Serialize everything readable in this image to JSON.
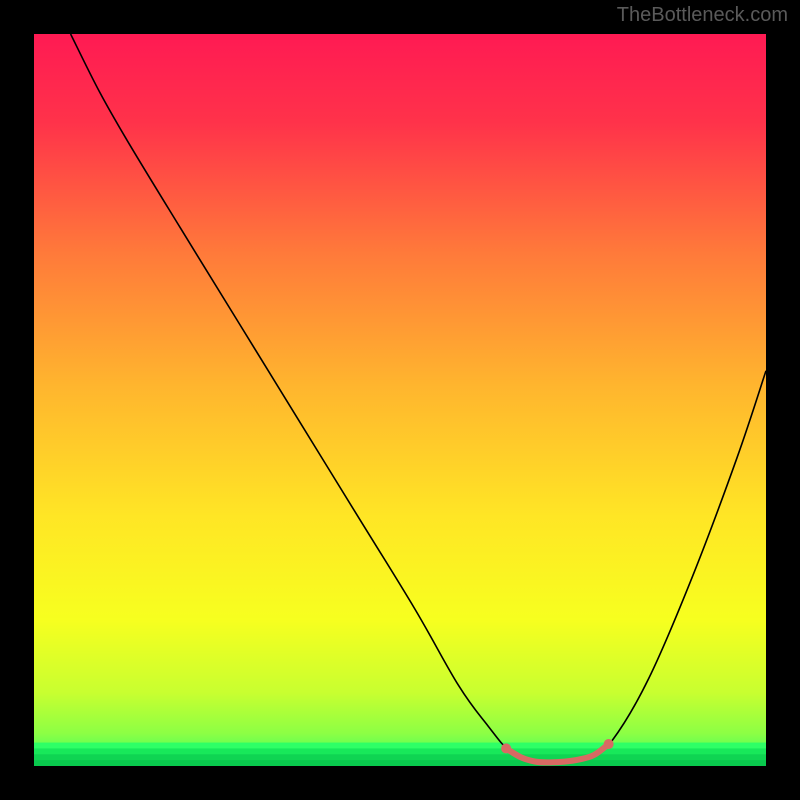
{
  "chart_data": {
    "type": "line",
    "attribution": "TheBottleneck.com",
    "title": "",
    "xlabel": "",
    "ylabel": "",
    "xlim": [
      0,
      100
    ],
    "ylim": [
      0,
      100
    ],
    "background_gradient": {
      "stops": [
        {
          "offset": 0.0,
          "color": "#ff1a53"
        },
        {
          "offset": 0.12,
          "color": "#ff324a"
        },
        {
          "offset": 0.3,
          "color": "#ff7a3a"
        },
        {
          "offset": 0.48,
          "color": "#ffb52e"
        },
        {
          "offset": 0.66,
          "color": "#ffe625"
        },
        {
          "offset": 0.8,
          "color": "#f7ff1f"
        },
        {
          "offset": 0.9,
          "color": "#c8ff30"
        },
        {
          "offset": 0.955,
          "color": "#8dff44"
        },
        {
          "offset": 1.0,
          "color": "#2eff66"
        }
      ]
    },
    "curve": {
      "color": "#000000",
      "width": 1.6,
      "points": [
        {
          "x": 5.0,
          "y": 100.0
        },
        {
          "x": 9.0,
          "y": 92.0
        },
        {
          "x": 13.0,
          "y": 85.0
        },
        {
          "x": 20.0,
          "y": 73.5
        },
        {
          "x": 28.0,
          "y": 60.5
        },
        {
          "x": 36.0,
          "y": 47.5
        },
        {
          "x": 44.0,
          "y": 34.5
        },
        {
          "x": 52.0,
          "y": 21.5
        },
        {
          "x": 58.0,
          "y": 11.0
        },
        {
          "x": 62.0,
          "y": 5.5
        },
        {
          "x": 65.0,
          "y": 2.0
        },
        {
          "x": 68.0,
          "y": 0.5
        },
        {
          "x": 72.0,
          "y": 0.5
        },
        {
          "x": 76.0,
          "y": 1.2
        },
        {
          "x": 79.0,
          "y": 3.5
        },
        {
          "x": 84.0,
          "y": 12.0
        },
        {
          "x": 90.0,
          "y": 26.0
        },
        {
          "x": 96.0,
          "y": 42.0
        },
        {
          "x": 100.0,
          "y": 54.0
        }
      ]
    },
    "highlight": {
      "color": "#d86a63",
      "width": 6,
      "cap_radius": 5,
      "points": [
        {
          "x": 64.5,
          "y": 2.4
        },
        {
          "x": 66.5,
          "y": 1.2
        },
        {
          "x": 68.5,
          "y": 0.6
        },
        {
          "x": 70.5,
          "y": 0.5
        },
        {
          "x": 72.5,
          "y": 0.6
        },
        {
          "x": 74.5,
          "y": 0.9
        },
        {
          "x": 76.5,
          "y": 1.5
        },
        {
          "x": 78.5,
          "y": 3.0
        }
      ]
    },
    "bottom_green_band": {
      "from_y": 0,
      "to_y": 3.2,
      "colors": [
        "#2eff66",
        "#18e85a",
        "#0fd452",
        "#09c94d"
      ]
    }
  }
}
